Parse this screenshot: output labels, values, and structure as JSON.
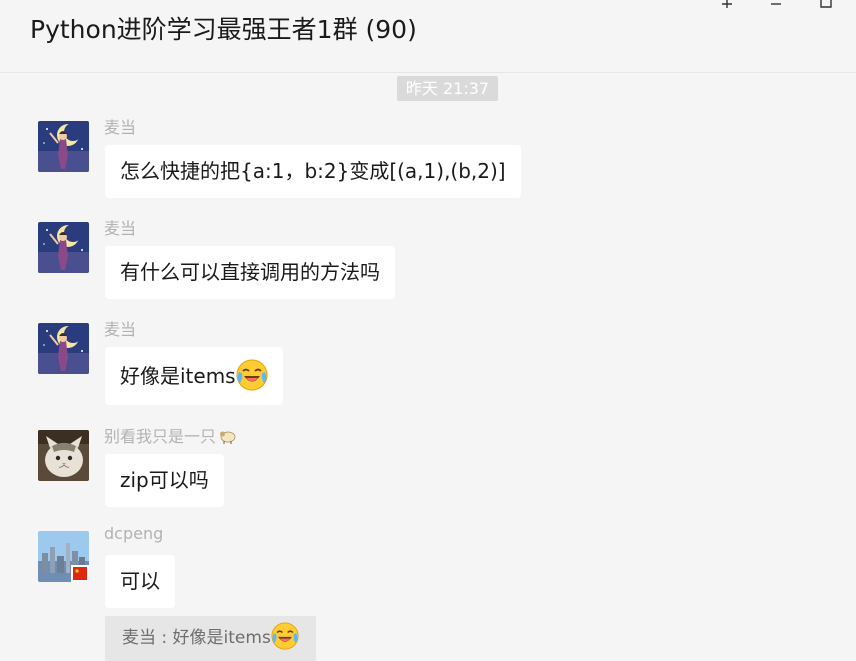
{
  "header": {
    "title": "Python进阶学习最强王者1群 (90)"
  },
  "timestamp": "昨天 21:37",
  "messages": [
    {
      "sender": "麦当",
      "avatar": "moon-character-avatar",
      "text": "怎么快捷的把{a:1，b:2}变成[(a,1),(b,2)]"
    },
    {
      "sender": "麦当",
      "avatar": "moon-character-avatar",
      "text": "有什么可以直接调用的方法吗"
    },
    {
      "sender": "麦当",
      "avatar": "moon-character-avatar",
      "text": "好像是items",
      "emoji": "crying-laughing-emoji"
    },
    {
      "sender": "别看我只是一只",
      "sender_icon": "sheep-icon",
      "avatar": "cat-avatar",
      "text": "zip可以吗"
    },
    {
      "sender": "dcpeng",
      "avatar": "city-skyline-avatar",
      "text": "可以"
    }
  ],
  "quote": {
    "text": "麦当 : 好像是items",
    "emoji": "crying-laughing-emoji"
  },
  "colors": {
    "background": "#f5f5f5",
    "bubble": "#ffffff",
    "timestamp_bg": "#dadada",
    "quote_bg": "#e6e6e6",
    "sender_text": "#b2b2b2"
  }
}
